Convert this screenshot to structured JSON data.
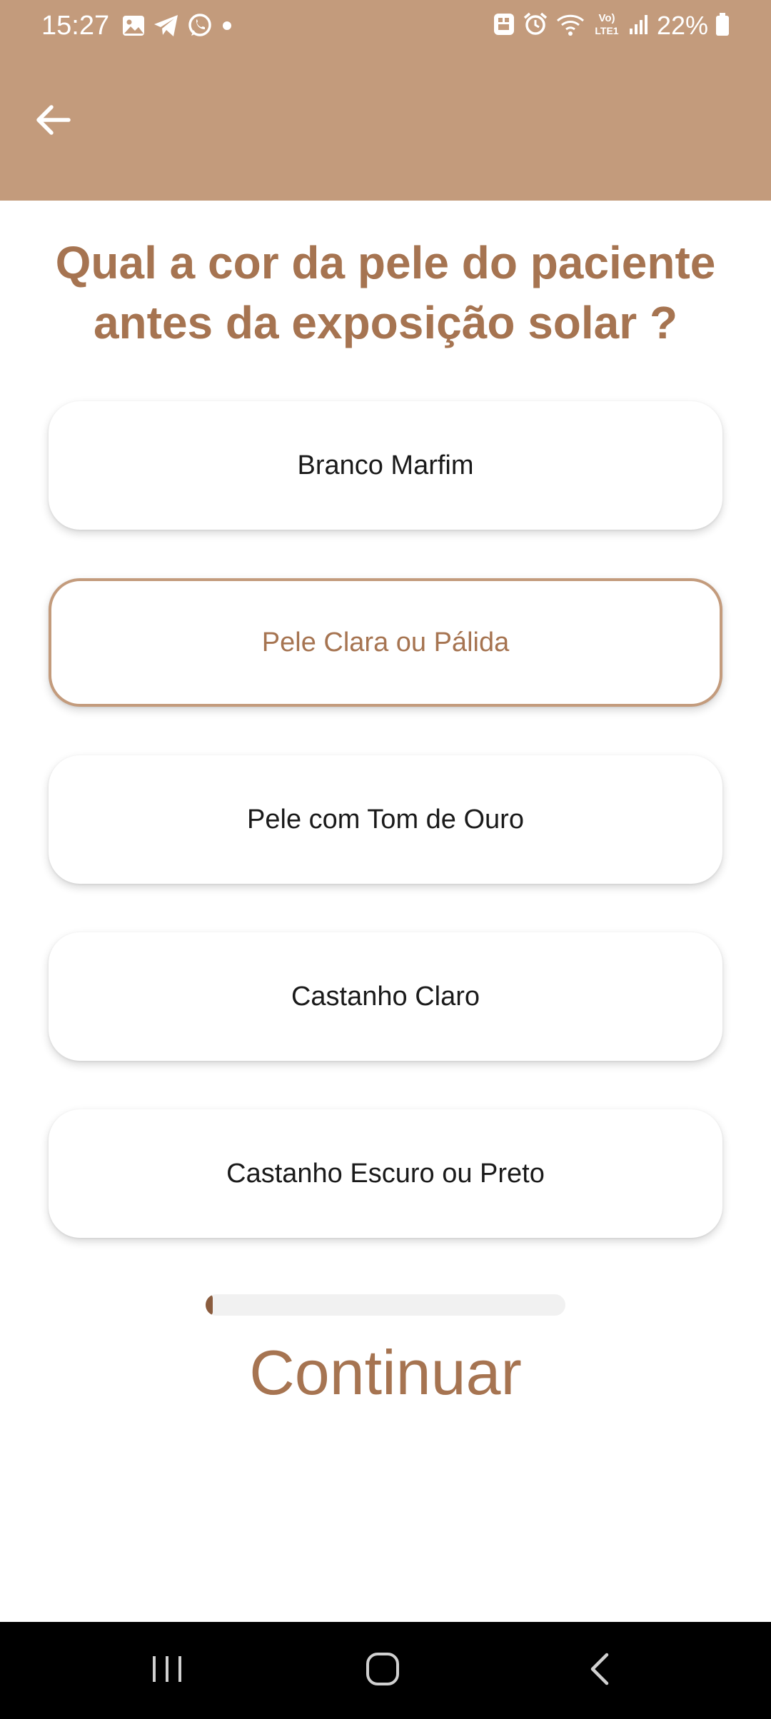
{
  "status_bar": {
    "time": "15:27",
    "left_icons": [
      "gallery-icon",
      "telegram-icon",
      "whatsapp-icon",
      "dot-icon"
    ],
    "right_icons": [
      "notification-icon",
      "alarm-icon",
      "wifi-icon",
      "volte-icon",
      "signal-icon",
      "battery-icon"
    ],
    "volte_line1": "Vo)",
    "volte_line2": "LTE1",
    "battery": "22%"
  },
  "header": {
    "back_icon": "arrow-back-icon",
    "color": "#c39b7c"
  },
  "question": {
    "line1": "Qual a cor da pele do paciente",
    "line2": "antes da exposição solar ?"
  },
  "options": [
    {
      "label": "Branco Marfim",
      "selected": false
    },
    {
      "label": "Pele Clara ou Pálida",
      "selected": true
    },
    {
      "label": "Pele com Tom de Ouro",
      "selected": false
    },
    {
      "label": "Castanho Claro",
      "selected": false
    },
    {
      "label": "Castanho Escuro ou Preto",
      "selected": false
    }
  ],
  "progress": {
    "value": 0.02
  },
  "continue_label": "Continuar",
  "nav_bar": {
    "icons": [
      "recent-apps-icon",
      "home-icon",
      "back-icon"
    ]
  },
  "colors": {
    "accent": "#a67451",
    "header": "#c39b7c",
    "progress_fill": "#8a5c3e"
  }
}
